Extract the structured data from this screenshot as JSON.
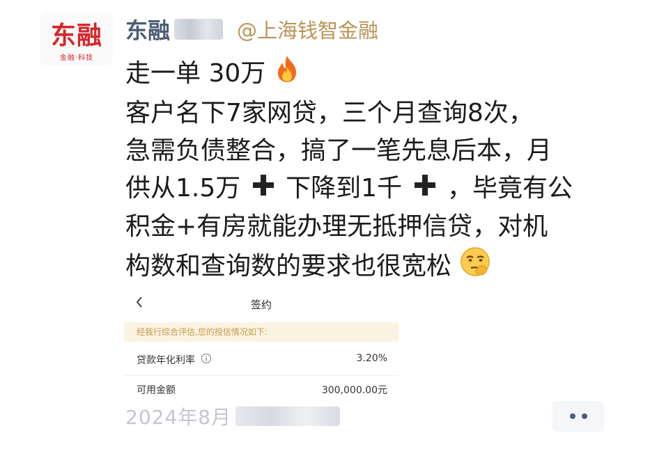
{
  "author": {
    "logo_main": "东融",
    "logo_sub": "金融·科技",
    "name": "东融",
    "org": "@上海钱智金融"
  },
  "post": {
    "lines": [
      "走一单 30万",
      "客户名下7家网贷，三个月查询8次，",
      "急需负债整合，搞了一笔先息后本，月",
      "供从1.5万",
      "下降到1千",
      "，毕竟有公",
      "积金+有房就能办理无抵押信贷，对机",
      "构数和查询数的要求也很宽松"
    ],
    "icons": [
      "fire-emoji",
      "plus-icon",
      "plus-icon",
      "smirk-emoji"
    ]
  },
  "screenshot": {
    "title": "签约",
    "banner": "经我行综合评估,您的授信情况如下:",
    "rate_label": "贷款年化利率",
    "rate_value": "3.20%",
    "amount_label": "可用金额",
    "amount_value": "300,000.00元"
  },
  "footer": {
    "date_prefix": "2024年8月"
  },
  "colors": {
    "name": "#4c5d74",
    "org": "#b89456",
    "brand_red": "#d6262b",
    "banner_bg": "#fbf3e1",
    "banner_text": "#c69a4a"
  }
}
